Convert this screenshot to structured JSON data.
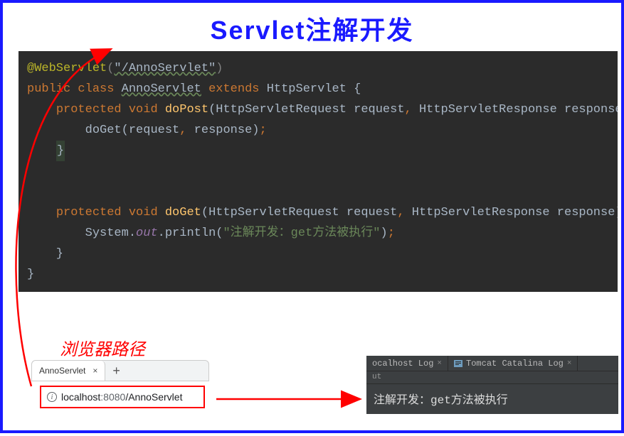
{
  "title": "Servlet注解开发",
  "code": {
    "annotation": "@WebServlet",
    "ann_path": "\"/AnnoServlet\"",
    "line1_kw1": "public",
    "line1_kw2": "class",
    "line1_cls": "AnnoServlet",
    "line1_kw3": "extends",
    "line1_sup": "HttpServlet",
    "line2_kw1": "protected",
    "line2_kw2": "void",
    "line2_mth": "doPost",
    "line2_p1t": "HttpServletRequest",
    "line2_p1n": "request",
    "line2_p2t": "HttpServletResponse",
    "line2_p2n": "response",
    "line3_call": "doGet",
    "line3_a1": "request",
    "line3_a2": "response",
    "line5_kw1": "protected",
    "line5_kw2": "void",
    "line5_mth": "doGet",
    "line5_p1t": "HttpServletRequest",
    "line5_p1n": "request",
    "line5_p2t": "HttpServletResponse",
    "line5_p2n": "response",
    "line6_sys": "System",
    "line6_out": "out",
    "line6_pr": "println",
    "line6_str": "\"注解开发：get方法被执行\""
  },
  "browser_label": "浏览器路径",
  "tab": {
    "title": "AnnoServlet",
    "close": "×",
    "add": "+"
  },
  "url": {
    "icon": "i",
    "host": "localhost",
    "port": ":8080",
    "path": "/AnnoServlet"
  },
  "console": {
    "tab1": "ocalhost Log",
    "tab2": "Tomcat Catalina Log",
    "close": "×",
    "sub": "ut",
    "output": "注解开发：get方法被执行"
  }
}
